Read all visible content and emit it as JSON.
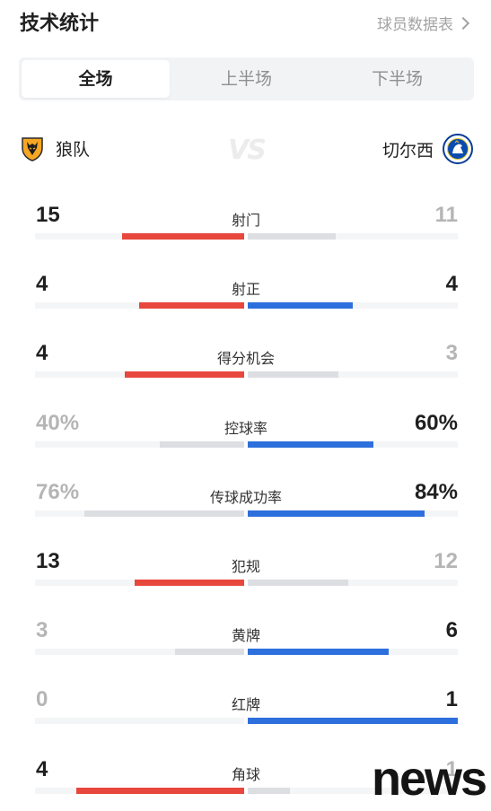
{
  "header": {
    "title": "技术统计",
    "link_label": "球员数据表"
  },
  "tabs": [
    {
      "label": "全场",
      "active": true
    },
    {
      "label": "上半场",
      "active": false
    },
    {
      "label": "下半场",
      "active": false
    }
  ],
  "teams": {
    "home": {
      "name": "狼队",
      "crest_icon": "wolves-crest-icon"
    },
    "away": {
      "name": "切尔西",
      "crest_icon": "chelsea-crest-icon"
    },
    "vs_label": "VS"
  },
  "colors": {
    "home": "#e8473d",
    "away": "#2d6fdc",
    "neutral": "#dcdee2",
    "track": "#f4f5f7"
  },
  "stats": [
    {
      "label": "射门",
      "home": "15",
      "away": "11",
      "home_share": 0.58,
      "away_share": 0.42,
      "leader": "home"
    },
    {
      "label": "射正",
      "home": "4",
      "away": "4",
      "home_share": 0.5,
      "away_share": 0.5,
      "leader": "both"
    },
    {
      "label": "得分机会",
      "home": "4",
      "away": "3",
      "home_share": 0.57,
      "away_share": 0.43,
      "leader": "home"
    },
    {
      "label": "控球率",
      "home": "40%",
      "away": "60%",
      "home_share": 0.4,
      "away_share": 0.6,
      "leader": "away"
    },
    {
      "label": "传球成功率",
      "home": "76%",
      "away": "84%",
      "home_share": 0.76,
      "away_share": 0.84,
      "leader": "away"
    },
    {
      "label": "犯规",
      "home": "13",
      "away": "12",
      "home_share": 0.52,
      "away_share": 0.48,
      "leader": "home"
    },
    {
      "label": "黄牌",
      "home": "3",
      "away": "6",
      "home_share": 0.33,
      "away_share": 0.67,
      "leader": "away"
    },
    {
      "label": "红牌",
      "home": "0",
      "away": "1",
      "home_share": 0.0,
      "away_share": 1.0,
      "leader": "away"
    },
    {
      "label": "角球",
      "home": "4",
      "away": "1",
      "home_share": 0.8,
      "away_share": 0.2,
      "leader": "home"
    }
  ],
  "watermark": "news"
}
